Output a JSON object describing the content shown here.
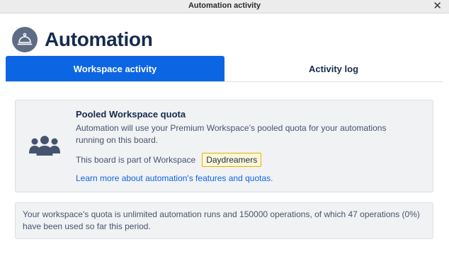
{
  "window": {
    "title": "Automation activity",
    "close_glyph": "✕"
  },
  "header": {
    "icon": "concierge-bell-icon",
    "title": "Automation"
  },
  "tabs": [
    {
      "label": "Workspace activity",
      "active": true
    },
    {
      "label": "Activity log",
      "active": false
    }
  ],
  "quota_card": {
    "icon": "team-icon",
    "heading": "Pooled Workspace quota",
    "description": "Automation will use your Premium Workspace’s pooled quota for your automations running on this board.",
    "workspace_prefix": "This board is part of Workspace",
    "workspace_name": "Daydreamers",
    "learn_more_link": "Learn more about automation's features and quotas."
  },
  "usage": {
    "text": "Your workspace's quota is unlimited automation runs and 150000 operations, of which 47 operations (0%) have been used so far this period."
  },
  "colors": {
    "accent": "#0c66e4",
    "card_bg": "#f1f2f4",
    "badge_bg": "#fff7d6",
    "icon": "#44546f"
  }
}
